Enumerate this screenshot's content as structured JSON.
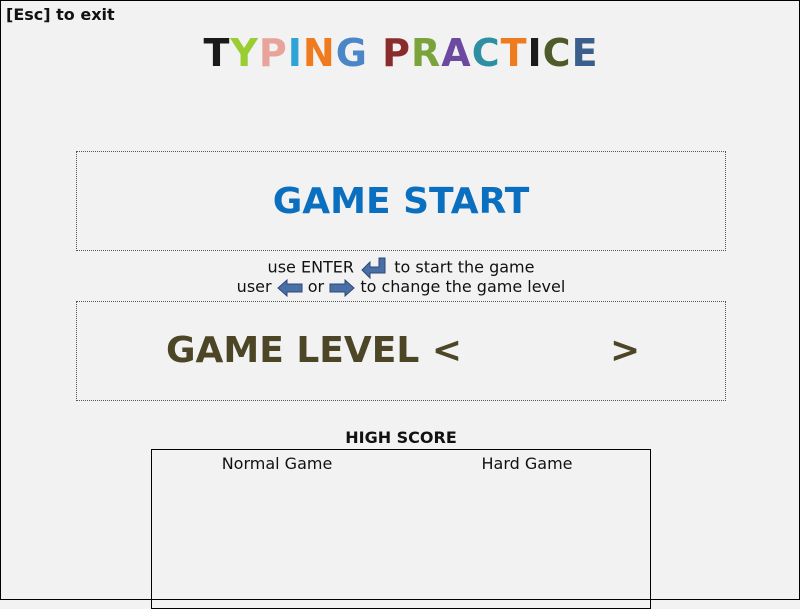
{
  "exit_hint": "[Esc] to exit",
  "title": {
    "text": "TYPING PRACTICE",
    "letters": [
      {
        "char": "T",
        "color": "#1a1a1a"
      },
      {
        "char": "Y",
        "color": "#9acd32"
      },
      {
        "char": "P",
        "color": "#e8a39a"
      },
      {
        "char": "I",
        "color": "#2ea3d6"
      },
      {
        "char": "N",
        "color": "#f07b1f"
      },
      {
        "char": "G",
        "color": "#4a86c8"
      },
      {
        "char": " ",
        "color": "#000000"
      },
      {
        "char": "P",
        "color": "#8b2c2c"
      },
      {
        "char": "R",
        "color": "#7aa33c"
      },
      {
        "char": "A",
        "color": "#6b4aa0"
      },
      {
        "char": "C",
        "color": "#2e8fa3"
      },
      {
        "char": "T",
        "color": "#f07b1f"
      },
      {
        "char": "I",
        "color": "#1a1a1a"
      },
      {
        "char": "C",
        "color": "#4f5a2a"
      },
      {
        "char": "E",
        "color": "#3a5f8a"
      }
    ]
  },
  "start": {
    "label": "GAME START",
    "color": "#0b6fc0"
  },
  "instructions": {
    "line1_before": "use ENTER",
    "line1_icon": "enter-key-icon",
    "line1_after": "to start the game",
    "line2_before": "user",
    "line2_left_icon": "left-arrow-icon",
    "line2_middle": "or",
    "line2_right_icon": "right-arrow-icon",
    "line2_after": "to change the game level",
    "arrow_color": "#4a6fa5"
  },
  "level": {
    "label": "GAME LEVEL <",
    "value": "",
    "right_chevron": ">",
    "color": "#4c4526"
  },
  "high_score": {
    "title": "HIGH SCORE",
    "columns": [
      "Normal Game",
      "Hard Game"
    ]
  }
}
